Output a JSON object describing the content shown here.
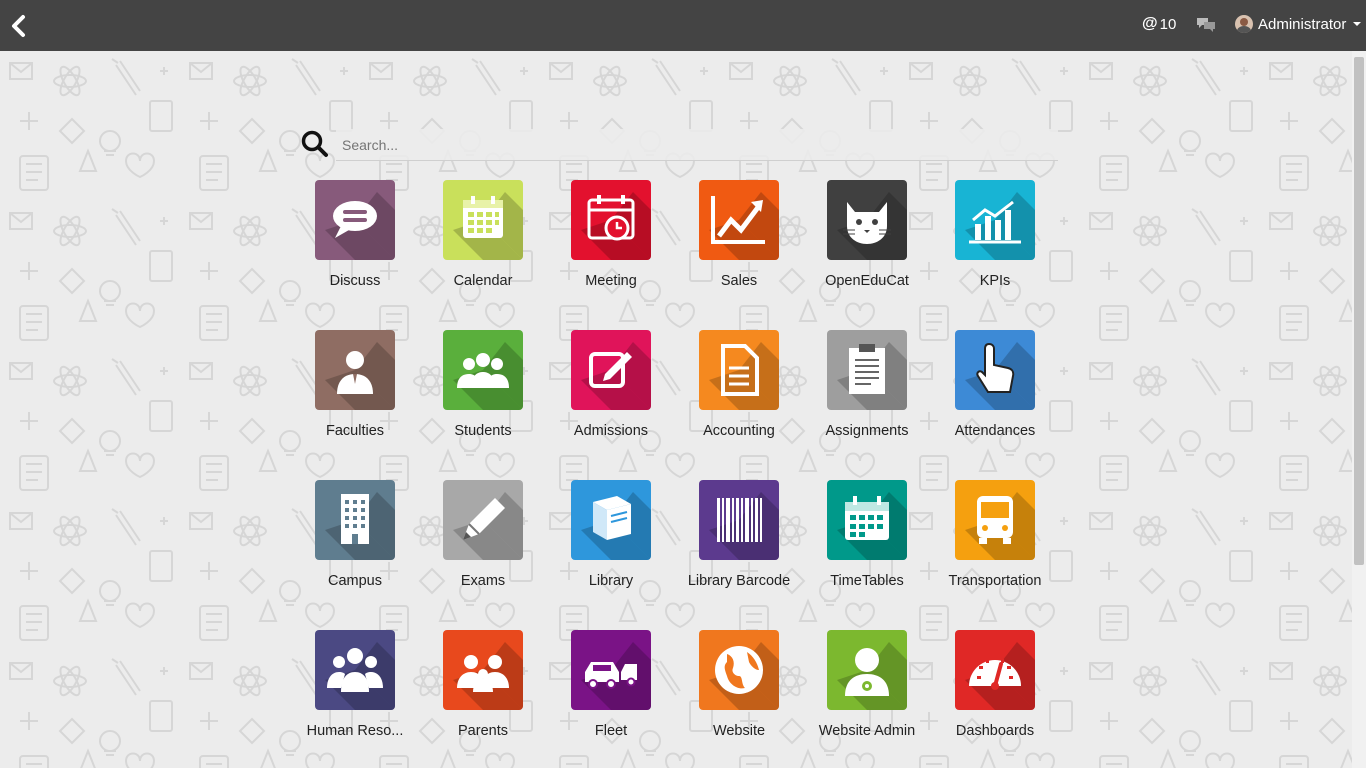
{
  "topbar": {
    "notifications_count": "10",
    "user_name": "Administrator"
  },
  "search": {
    "placeholder": "Search..."
  },
  "apps": [
    {
      "label": "Discuss",
      "color": "#875A7B",
      "icon": "speech-bubble-icon"
    },
    {
      "label": "Calendar",
      "color": "#C9E05B",
      "icon": "calendar-icon"
    },
    {
      "label": "Meeting",
      "color": "#E3112E",
      "icon": "calendar-clock-icon"
    },
    {
      "label": "Sales",
      "color": "#F05A12",
      "icon": "trending-chart-icon"
    },
    {
      "label": "OpenEduCat",
      "color": "#404040",
      "icon": "cat-icon"
    },
    {
      "label": "KPIs",
      "color": "#18B4D4",
      "icon": "bar-chart-icon"
    },
    {
      "label": "Faculties",
      "color": "#8F6D63",
      "icon": "businessman-icon"
    },
    {
      "label": "Students",
      "color": "#5AAF3C",
      "icon": "group-icon"
    },
    {
      "label": "Admissions",
      "color": "#E0145A",
      "icon": "edit-icon"
    },
    {
      "label": "Accounting",
      "color": "#F5891F",
      "icon": "document-icon"
    },
    {
      "label": "Assignments",
      "color": "#9E9E9E",
      "icon": "clipboard-icon"
    },
    {
      "label": "Attendances",
      "color": "#3D8AD6",
      "icon": "hand-pointer-icon"
    },
    {
      "label": "Campus",
      "color": "#5F7D8F",
      "icon": "building-icon"
    },
    {
      "label": "Exams",
      "color": "#A8A8A8",
      "icon": "pencil-icon"
    },
    {
      "label": "Library",
      "color": "#2E97DC",
      "icon": "book-icon"
    },
    {
      "label": "Library Barcode",
      "color": "#5C3A8E",
      "icon": "barcode-icon"
    },
    {
      "label": "TimeTables",
      "color": "#00998A",
      "icon": "calendar-grid-icon"
    },
    {
      "label": "Transportation",
      "color": "#F5A00F",
      "icon": "bus-icon"
    },
    {
      "label": "Human Reso...",
      "color": "#4B4983",
      "icon": "people-icon"
    },
    {
      "label": "Parents",
      "color": "#E8491D",
      "icon": "family-icon"
    },
    {
      "label": "Fleet",
      "color": "#7A1386",
      "icon": "cars-icon"
    },
    {
      "label": "Website",
      "color": "#F0771E",
      "icon": "globe-icon"
    },
    {
      "label": "Website Admin",
      "color": "#7CB82F",
      "icon": "user-gear-icon"
    },
    {
      "label": "Dashboards",
      "color": "#E02826",
      "icon": "speedometer-icon"
    }
  ]
}
